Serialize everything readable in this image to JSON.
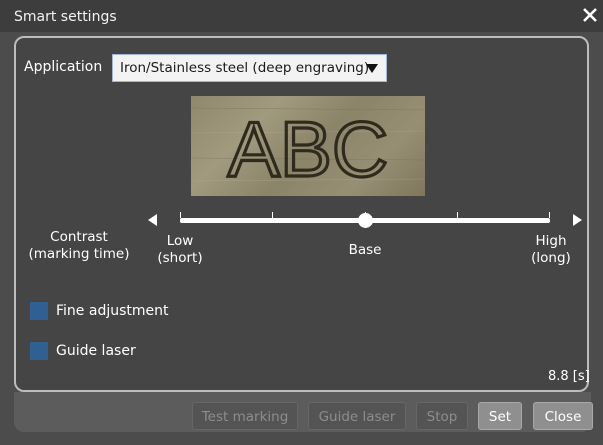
{
  "window": {
    "title": "Smart settings"
  },
  "application": {
    "label": "Application",
    "selected": "Iron/Stainless steel (deep engraving)"
  },
  "preview": {
    "sample_text": "ABC"
  },
  "contrast": {
    "label_line1": "Contrast",
    "label_line2": "(marking time)",
    "low_line1": "Low",
    "low_line2": "(short)",
    "base": "Base",
    "high_line1": "High",
    "high_line2": "(long)",
    "level": 0.5
  },
  "options": {
    "fine_adjustment": "Fine adjustment",
    "guide_laser": "Guide laser"
  },
  "marking_time": "8.8 [s]",
  "buttons": {
    "test_marking": "Test marking",
    "guide_laser": "Guide laser",
    "stop": "Stop",
    "set": "Set",
    "close": "Close"
  },
  "colors": {
    "checkbox": "#2f5f93",
    "window_bg": "#4c4c4c",
    "panel_bg": "#454545"
  }
}
